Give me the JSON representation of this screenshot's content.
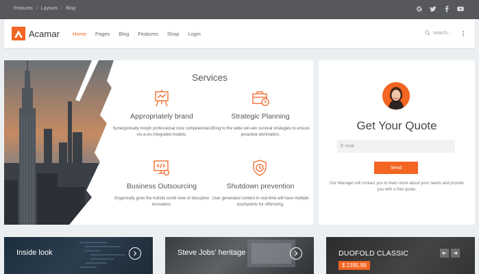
{
  "topbar": {
    "breadcrumb": [
      "Features",
      "Layouts",
      "Blog"
    ],
    "breadcrumb_sep": "/",
    "socials": [
      "google-icon",
      "twitter-icon",
      "facebook-icon",
      "youtube-icon"
    ]
  },
  "header": {
    "logo_text": "Acamar",
    "menu": [
      "Home",
      "Pages",
      "Blog",
      "Features",
      "Shop",
      "Login"
    ],
    "active_menu": "Home",
    "search_placeholder": "search..."
  },
  "services": {
    "title": "Services",
    "items": [
      {
        "icon": "presentation-board-icon",
        "title": "Appropriately brand",
        "desc": "Synergistically morph professional core competencies vis-a-vis integrated models."
      },
      {
        "icon": "briefcase-clock-icon",
        "title": "Strategic Planning",
        "desc": "Bring to the table win-win survival strategies to ensure proactive domination."
      },
      {
        "icon": "code-monitor-icon",
        "title": "Business Outsourcing",
        "desc": "Organically grow the holistic world view of disruptive innovation."
      },
      {
        "icon": "shield-clock-icon",
        "title": "Shutdown prevention",
        "desc": "User generated content in real-time will have multiple touchpoints for offshoring."
      }
    ]
  },
  "quote": {
    "title": "Get Your Quote",
    "email_placeholder": "E-mail",
    "button": "Send",
    "note": "Our Manager will contact you to learn more about your needs and provide you with a free quote."
  },
  "tiles": [
    {
      "label": "Inside look"
    },
    {
      "label": "Steve Jobs' heritage"
    },
    {
      "label": "DUOFOLD CLASSIC",
      "price": "$ 2395.99"
    }
  ],
  "colors": {
    "accent": "#f26522",
    "topbar": "#56585c"
  }
}
